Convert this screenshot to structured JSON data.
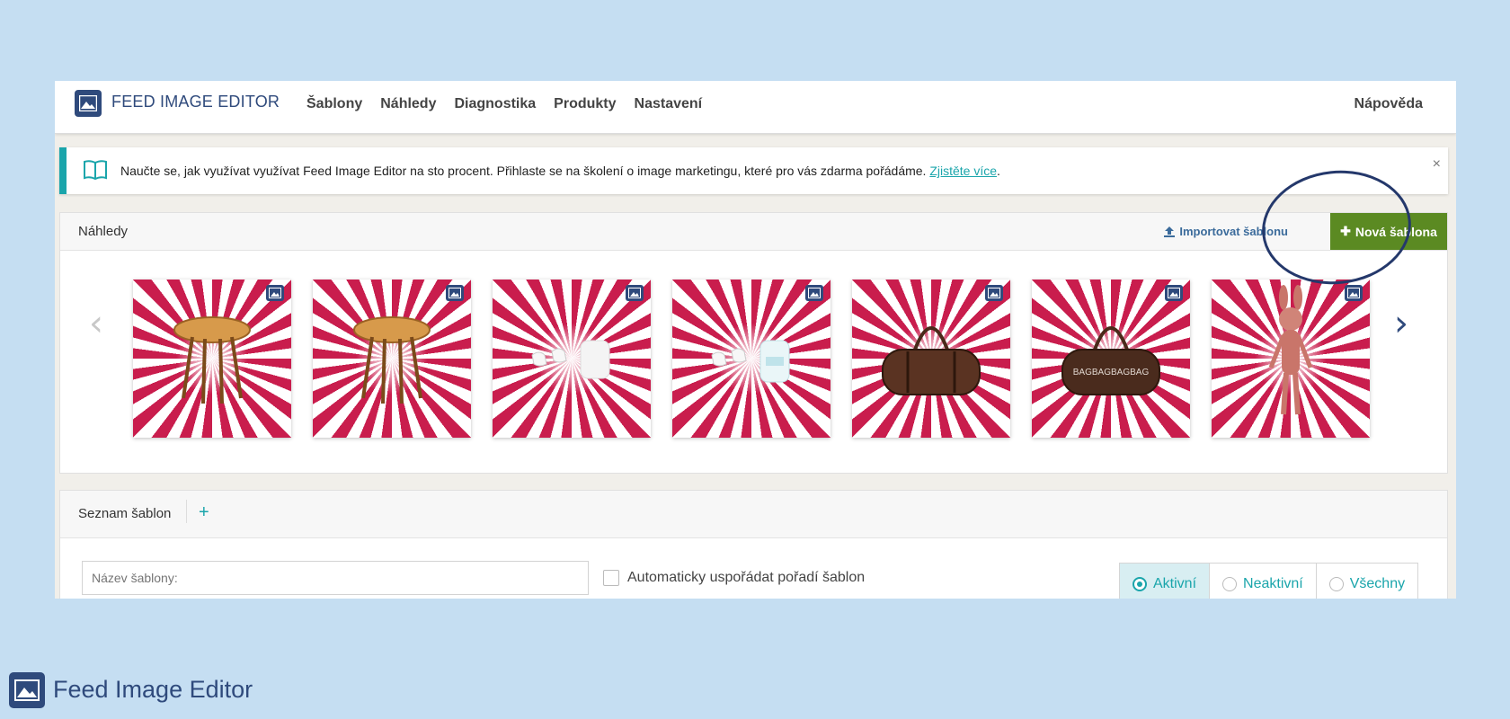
{
  "app": {
    "logo_text": "FEED IMAGE EDITOR",
    "nav": [
      "Šablony",
      "Náhledy",
      "Diagnostika",
      "Produkty",
      "Nastavení"
    ],
    "help": "Nápověda"
  },
  "banner": {
    "text": "Naučte se, jak využívat využívat Feed Image Editor na sto procent. Přihlaste se na školení o image marketingu, které pro vás zdarma pořádáme.",
    "link": "Zjistěte více",
    "suffix": ".",
    "close": "×"
  },
  "previews": {
    "title": "Náhledy",
    "import_label": "Importovat šablonu",
    "new_label": "Nová šablona",
    "thumbnails": [
      {
        "product": "table"
      },
      {
        "product": "table"
      },
      {
        "product": "earbuds"
      },
      {
        "product": "earbuds"
      },
      {
        "product": "bag"
      },
      {
        "product": "bag",
        "label": "BAGBAGBAGBAG"
      },
      {
        "product": "bunny"
      }
    ]
  },
  "templates": {
    "title": "Seznam šablon",
    "add": "+",
    "name_placeholder": "Název šablony:",
    "auto_sort_label": "Automaticky uspořádat pořadí šablon",
    "filters": [
      "Aktivní",
      "Neaktivní",
      "Všechny"
    ]
  },
  "footer": {
    "brand": "Feed Image Editor"
  },
  "colors": {
    "brand": "#2f4a7c",
    "accent": "#1aa5ab",
    "button": "#5b8a22",
    "stripe": "#c91d4d"
  }
}
